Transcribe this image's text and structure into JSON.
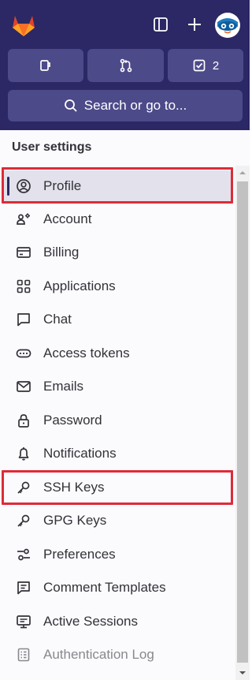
{
  "header": {
    "logo_icon": "gitlab-tanuki-logo",
    "sidebar_toggle_icon": "sidebar-toggle-icon",
    "new_icon": "plus-icon",
    "avatar_icon": "user-avatar"
  },
  "quick_actions": {
    "issues_icon": "issues-icon",
    "merge_requests_icon": "merge-request-icon",
    "todos_icon": "todo-check-icon",
    "todos_count": "2"
  },
  "search": {
    "label": "Search or go to...",
    "icon": "search-icon"
  },
  "sidebar": {
    "title": "User settings",
    "items": [
      {
        "label": "Profile",
        "icon": "user-circle-icon",
        "active": true,
        "highlighted": true
      },
      {
        "label": "Account",
        "icon": "account-gear-icon"
      },
      {
        "label": "Billing",
        "icon": "credit-card-icon"
      },
      {
        "label": "Applications",
        "icon": "applications-grid-icon"
      },
      {
        "label": "Chat",
        "icon": "comment-icon"
      },
      {
        "label": "Access tokens",
        "icon": "token-icon"
      },
      {
        "label": "Emails",
        "icon": "mail-icon"
      },
      {
        "label": "Password",
        "icon": "lock-icon"
      },
      {
        "label": "Notifications",
        "icon": "bell-icon"
      },
      {
        "label": "SSH Keys",
        "icon": "key-icon",
        "highlighted": true
      },
      {
        "label": "GPG Keys",
        "icon": "key-icon"
      },
      {
        "label": "Preferences",
        "icon": "preferences-icon"
      },
      {
        "label": "Comment Templates",
        "icon": "comment-lines-icon"
      },
      {
        "label": "Active Sessions",
        "icon": "monitor-icon"
      },
      {
        "label": "Authentication Log",
        "icon": "log-icon"
      }
    ]
  },
  "colors": {
    "header_bg": "#2b2865",
    "button_bg": "#4d4a8a",
    "sidebar_bg": "#fbfafd",
    "active_bg": "#e3e2ec",
    "highlight_border": "#dd2b38",
    "text": "#333238"
  }
}
